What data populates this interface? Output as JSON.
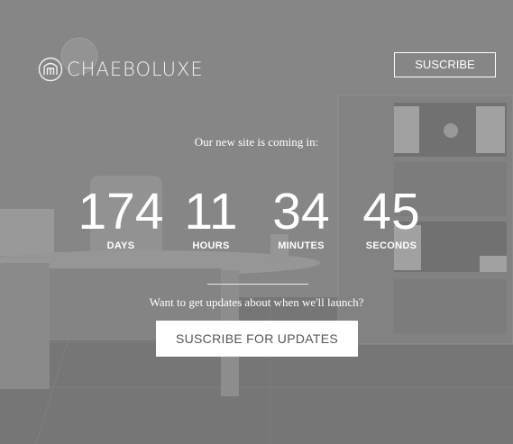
{
  "brand": {
    "name": "CHAEBOLUXE",
    "icon": "logo-mark-icon"
  },
  "header": {
    "subscribe_label": "SUSCRIBE"
  },
  "hero": {
    "coming_text": "Our new site is coming in:",
    "countdown": [
      {
        "value": "174",
        "label": "DAYS"
      },
      {
        "value": "11",
        "label": "HOURS"
      },
      {
        "value": "34",
        "label": "MINUTES"
      },
      {
        "value": "45",
        "label": "SECONDS"
      }
    ],
    "updates_text": "Want to get updates about when we'll launch?",
    "subscribe_label": "SUSCRIBE FOR UPDATES"
  },
  "colors": {
    "text": "#ffffff",
    "button_bg": "#ffffff",
    "button_text": "#555555"
  }
}
